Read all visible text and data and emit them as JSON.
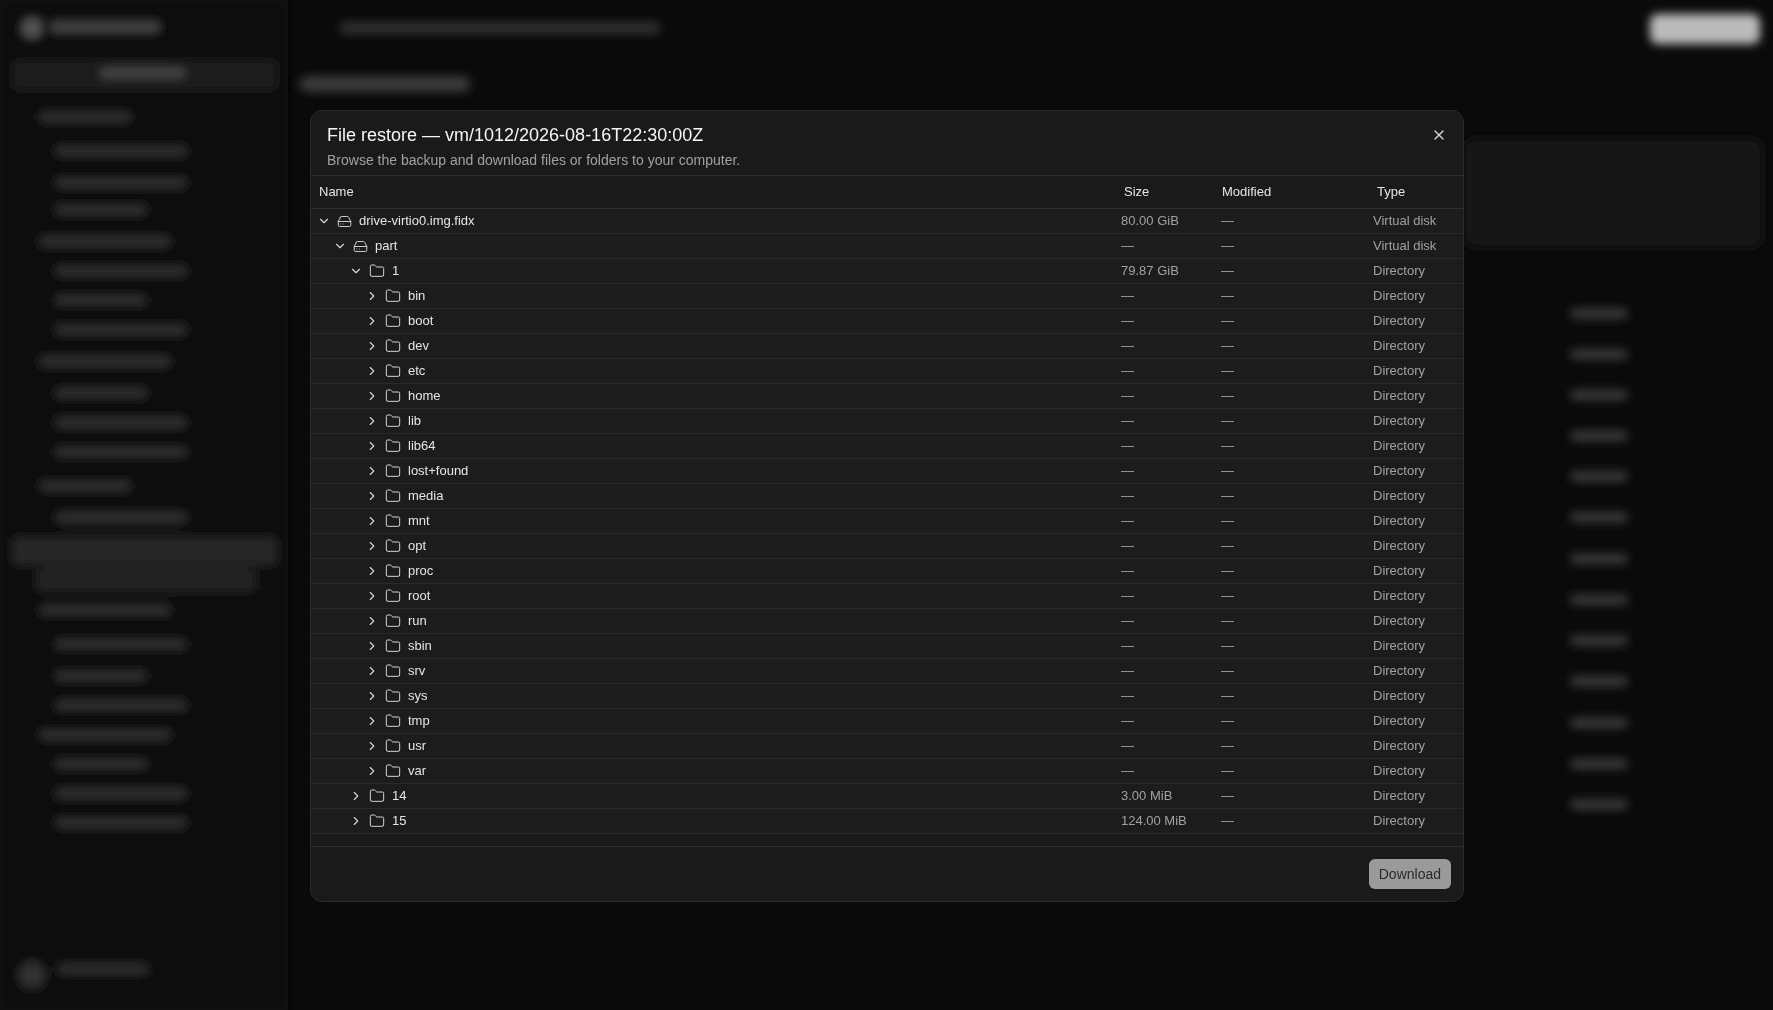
{
  "dialog": {
    "title": "File restore — vm/1012/2026-08-16T22:30:00Z",
    "subtitle": "Browse the backup and download files or folders to your computer.",
    "columns": [
      "Name",
      "Size",
      "Modified",
      "Type"
    ],
    "tree": [
      {
        "name": "drive-virtio0.img.fidx",
        "kind": "disk",
        "size": "80.00 GiB",
        "modified": "—",
        "type": "Virtual disk",
        "expanded": true,
        "children": [
          {
            "name": "part",
            "kind": "disk",
            "size": "—",
            "modified": "—",
            "type": "Virtual disk",
            "expanded": true,
            "children": [
              {
                "name": "1",
                "kind": "folder",
                "size": "79.87 GiB",
                "modified": "—",
                "type": "Directory",
                "expanded": true,
                "children": [
                  {
                    "name": "bin",
                    "kind": "folder",
                    "size": "—",
                    "modified": "—",
                    "type": "Directory",
                    "expanded": false
                  },
                  {
                    "name": "boot",
                    "kind": "folder",
                    "size": "—",
                    "modified": "—",
                    "type": "Directory",
                    "expanded": false
                  },
                  {
                    "name": "dev",
                    "kind": "folder",
                    "size": "—",
                    "modified": "—",
                    "type": "Directory",
                    "expanded": false
                  },
                  {
                    "name": "etc",
                    "kind": "folder",
                    "size": "—",
                    "modified": "—",
                    "type": "Directory",
                    "expanded": false
                  },
                  {
                    "name": "home",
                    "kind": "folder",
                    "size": "—",
                    "modified": "—",
                    "type": "Directory",
                    "expanded": false
                  },
                  {
                    "name": "lib",
                    "kind": "folder",
                    "size": "—",
                    "modified": "—",
                    "type": "Directory",
                    "expanded": false
                  },
                  {
                    "name": "lib64",
                    "kind": "folder",
                    "size": "—",
                    "modified": "—",
                    "type": "Directory",
                    "expanded": false
                  },
                  {
                    "name": "lost+found",
                    "kind": "folder",
                    "size": "—",
                    "modified": "—",
                    "type": "Directory",
                    "expanded": false
                  },
                  {
                    "name": "media",
                    "kind": "folder",
                    "size": "—",
                    "modified": "—",
                    "type": "Directory",
                    "expanded": false
                  },
                  {
                    "name": "mnt",
                    "kind": "folder",
                    "size": "—",
                    "modified": "—",
                    "type": "Directory",
                    "expanded": false
                  },
                  {
                    "name": "opt",
                    "kind": "folder",
                    "size": "—",
                    "modified": "—",
                    "type": "Directory",
                    "expanded": false
                  },
                  {
                    "name": "proc",
                    "kind": "folder",
                    "size": "—",
                    "modified": "—",
                    "type": "Directory",
                    "expanded": false
                  },
                  {
                    "name": "root",
                    "kind": "folder",
                    "size": "—",
                    "modified": "—",
                    "type": "Directory",
                    "expanded": false
                  },
                  {
                    "name": "run",
                    "kind": "folder",
                    "size": "—",
                    "modified": "—",
                    "type": "Directory",
                    "expanded": false
                  },
                  {
                    "name": "sbin",
                    "kind": "folder",
                    "size": "—",
                    "modified": "—",
                    "type": "Directory",
                    "expanded": false
                  },
                  {
                    "name": "srv",
                    "kind": "folder",
                    "size": "—",
                    "modified": "—",
                    "type": "Directory",
                    "expanded": false
                  },
                  {
                    "name": "sys",
                    "kind": "folder",
                    "size": "—",
                    "modified": "—",
                    "type": "Directory",
                    "expanded": false
                  },
                  {
                    "name": "tmp",
                    "kind": "folder",
                    "size": "—",
                    "modified": "—",
                    "type": "Directory",
                    "expanded": false
                  },
                  {
                    "name": "usr",
                    "kind": "folder",
                    "size": "—",
                    "modified": "—",
                    "type": "Directory",
                    "expanded": false
                  },
                  {
                    "name": "var",
                    "kind": "folder",
                    "size": "—",
                    "modified": "—",
                    "type": "Directory",
                    "expanded": false
                  }
                ]
              },
              {
                "name": "14",
                "kind": "folder",
                "size": "3.00 MiB",
                "modified": "—",
                "type": "Directory",
                "expanded": false
              },
              {
                "name": "15",
                "kind": "folder",
                "size": "124.00 MiB",
                "modified": "—",
                "type": "Directory",
                "expanded": false
              }
            ]
          }
        ]
      }
    ],
    "download": {
      "label": "Download",
      "disabled": true
    }
  }
}
